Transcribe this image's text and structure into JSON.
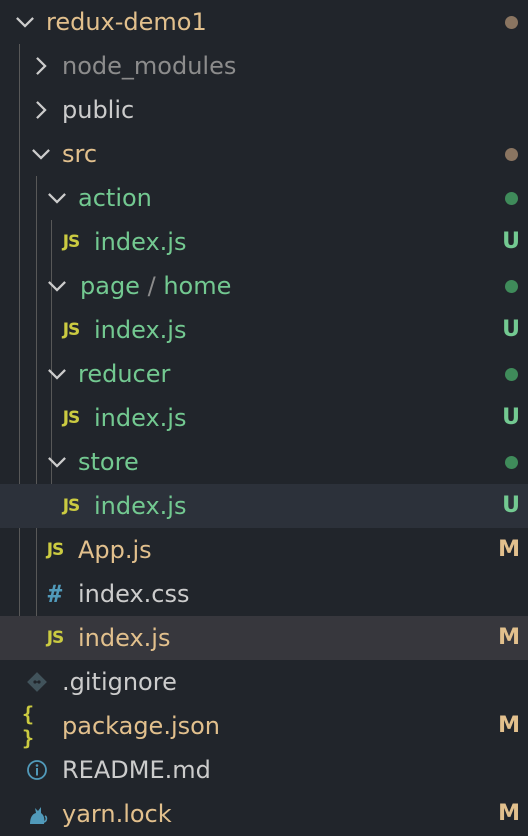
{
  "explorer": {
    "root": {
      "label": "redux-demo1"
    },
    "node_modules": {
      "label": "node_modules"
    },
    "public": {
      "label": "public"
    },
    "src": {
      "label": "src"
    },
    "action": {
      "label": "action"
    },
    "action_index": {
      "label": "index.js",
      "status": "U"
    },
    "page_home": {
      "label_a": "page",
      "separator": "/",
      "label_b": "home"
    },
    "page_index": {
      "label": "index.js",
      "status": "U"
    },
    "reducer": {
      "label": "reducer"
    },
    "reducer_index": {
      "label": "index.js",
      "status": "U"
    },
    "store": {
      "label": "store"
    },
    "store_index": {
      "label": "index.js",
      "status": "U"
    },
    "app_js": {
      "label": "App.js",
      "status": "M"
    },
    "index_css": {
      "label": "index.css"
    },
    "index_js": {
      "label": "index.js",
      "status": "M"
    },
    "gitignore": {
      "label": ".gitignore"
    },
    "package_json": {
      "label": "package.json",
      "status": "M"
    },
    "readme": {
      "label": "README.md"
    },
    "yarn_lock": {
      "label": "yarn.lock",
      "status": "M"
    },
    "icons": {
      "js": "JS",
      "css": "#",
      "json": "{ }"
    }
  },
  "colors": {
    "modified": "#e2c08d",
    "untracked": "#73c991",
    "ignored": "#8c8c8c",
    "background": "#21252b"
  }
}
